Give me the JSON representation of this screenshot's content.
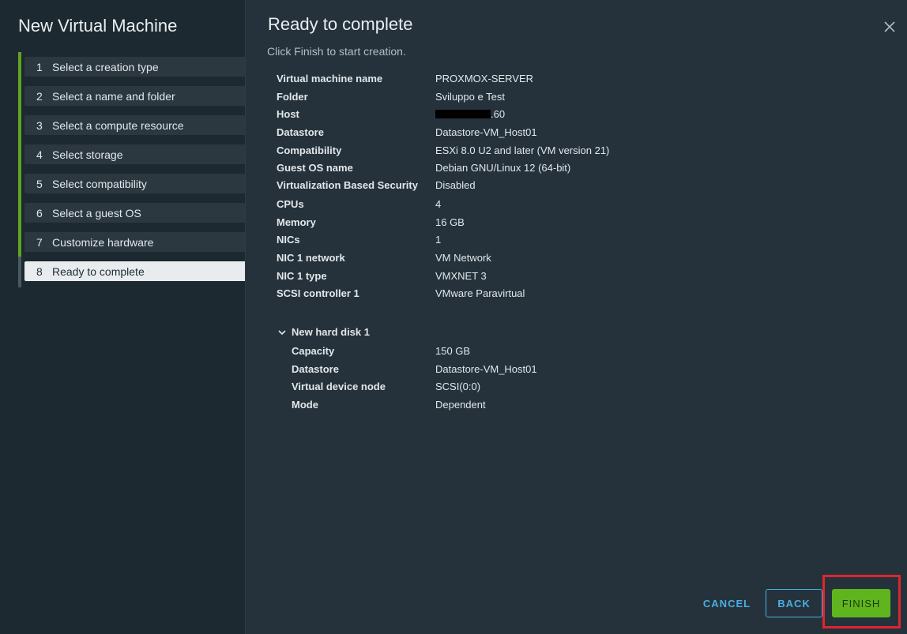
{
  "sidebar": {
    "title": "New Virtual Machine",
    "steps": [
      {
        "num": "1",
        "label": "Select a creation type"
      },
      {
        "num": "2",
        "label": "Select a name and folder"
      },
      {
        "num": "3",
        "label": "Select a compute resource"
      },
      {
        "num": "4",
        "label": "Select storage"
      },
      {
        "num": "5",
        "label": "Select compatibility"
      },
      {
        "num": "6",
        "label": "Select a guest OS"
      },
      {
        "num": "7",
        "label": "Customize hardware"
      },
      {
        "num": "8",
        "label": "Ready to complete"
      }
    ],
    "current_step": "8"
  },
  "main": {
    "title": "Ready to complete",
    "subtitle": "Click Finish to start creation.",
    "summary": [
      {
        "key": "Virtual machine name",
        "value": "PROXMOX-SERVER"
      },
      {
        "key": "Folder",
        "value": "Sviluppo e Test"
      },
      {
        "key": "Host",
        "value": ".60"
      },
      {
        "key": "Datastore",
        "value": "Datastore-VM_Host01"
      },
      {
        "key": "Compatibility",
        "value": "ESXi 8.0 U2 and later (VM version 21)"
      },
      {
        "key": "Guest OS name",
        "value": "Debian GNU/Linux 12 (64-bit)"
      },
      {
        "key": "Virtualization Based Security",
        "value": "Disabled"
      },
      {
        "key": "CPUs",
        "value": "4"
      },
      {
        "key": "Memory",
        "value": "16 GB"
      },
      {
        "key": "NICs",
        "value": "1"
      },
      {
        "key": "NIC 1 network",
        "value": "VM Network"
      },
      {
        "key": "NIC 1 type",
        "value": "VMXNET 3"
      },
      {
        "key": "SCSI controller 1",
        "value": "VMware Paravirtual"
      }
    ],
    "disk": {
      "label": "New hard disk 1",
      "rows": [
        {
          "key": "Capacity",
          "value": "150 GB"
        },
        {
          "key": "Datastore",
          "value": "Datastore-VM_Host01"
        },
        {
          "key": "Virtual device node",
          "value": "SCSI(0:0)"
        },
        {
          "key": "Mode",
          "value": "Dependent"
        }
      ]
    }
  },
  "buttons": {
    "cancel": "CANCEL",
    "back": "BACK",
    "finish": "FINISH"
  },
  "colors": {
    "accent_green": "#62a420",
    "link_blue": "#4aaee0",
    "highlight_red": "#e0252c"
  },
  "icons": {
    "close": "close-icon",
    "chevron": "chevron-down-icon"
  }
}
